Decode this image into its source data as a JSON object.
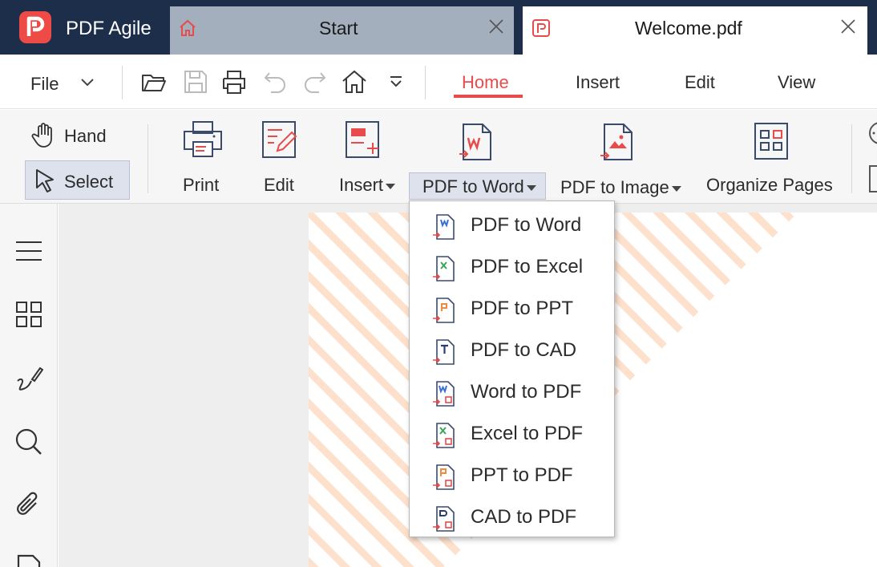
{
  "app": {
    "name": "PDF Agile"
  },
  "tabs": [
    {
      "title": "Start",
      "active": false
    },
    {
      "title": "Welcome.pdf",
      "active": true
    }
  ],
  "menu": {
    "file_label": "File",
    "ribbon_tabs": [
      "Home",
      "Insert",
      "Edit",
      "View"
    ],
    "active_tab": "Home"
  },
  "ribbon": {
    "hand_label": "Hand",
    "select_label": "Select",
    "print_label": "Print",
    "edit_label": "Edit",
    "insert_label": "Insert",
    "pdf_to_word_label": "PDF to Word",
    "pdf_to_image_label": "PDF to Image",
    "organize_pages_label": "Organize Pages"
  },
  "dropdown": {
    "items": [
      {
        "label": "PDF to Word",
        "icon": "pdf-to-word-icon"
      },
      {
        "label": "PDF to Excel",
        "icon": "pdf-to-excel-icon"
      },
      {
        "label": "PDF to PPT",
        "icon": "pdf-to-ppt-icon"
      },
      {
        "label": "PDF to CAD",
        "icon": "pdf-to-cad-icon"
      },
      {
        "label": "Word to PDF",
        "icon": "word-to-pdf-icon"
      },
      {
        "label": "Excel to PDF",
        "icon": "excel-to-pdf-icon"
      },
      {
        "label": "PPT to PDF",
        "icon": "ppt-to-pdf-icon"
      },
      {
        "label": "CAD to PDF",
        "icon": "cad-to-pdf-icon"
      }
    ]
  },
  "colors": {
    "titlebar": "#1c2e4a",
    "accent": "#e84b4b",
    "icon_navy": "#3a4a6b",
    "selected_bg": "#dde2ec"
  }
}
